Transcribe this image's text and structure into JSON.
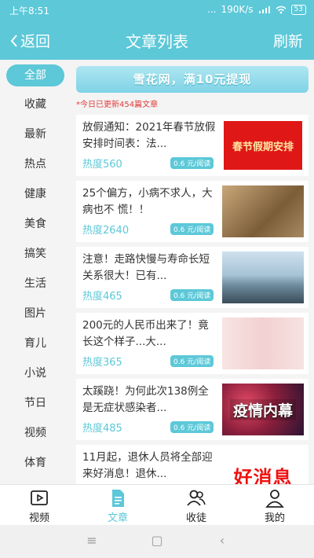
{
  "status_bar": {
    "time": "上午8:51",
    "dots": "...",
    "speed": "190K/s",
    "battery": "53"
  },
  "header": {
    "back_label": "返回",
    "title": "文章列表",
    "refresh_label": "刷新"
  },
  "sidebar": {
    "categories": [
      "全部",
      "收藏",
      "最新",
      "热点",
      "健康",
      "美食",
      "搞笑",
      "生活",
      "图片",
      "育儿",
      "小说",
      "节日",
      "视频",
      "体育"
    ],
    "active_index": 0
  },
  "banner": {
    "text": "雪花网，满10元提现"
  },
  "notice": "*今日已更新454篇文章",
  "articles": [
    {
      "title": "放假通知：2021年春节放假安排时间表：法...",
      "heat": "热度560",
      "price": "0.6 元/阅读",
      "thumb_text": "春节假期安排"
    },
    {
      "title": "25个偏方，小病不求人，大病也不 慌！！",
      "heat": "热度2640",
      "price": "0.6 元/阅读",
      "thumb_text": ""
    },
    {
      "title": "注意！走路快慢与寿命长短关系很大！已有...",
      "heat": "热度465",
      "price": "0.6 元/阅读",
      "thumb_text": ""
    },
    {
      "title": "200元的人民币出来了！竟长这个样子...大...",
      "heat": "热度365",
      "price": "0.6 元/阅读",
      "thumb_text": ""
    },
    {
      "title": "太蹊跷！为何此次138例全是无症状感染者...",
      "heat": "热度485",
      "price": "0.6 元/阅读",
      "thumb_text": "疫情内幕"
    },
    {
      "title": "11月起，退休人员将全部迎来好消息！退休...",
      "heat": "",
      "price": "",
      "thumb_text": "好消息"
    }
  ],
  "tabs": [
    {
      "label": "视频",
      "icon": "video-icon"
    },
    {
      "label": "文章",
      "icon": "document-icon"
    },
    {
      "label": "收徒",
      "icon": "users-icon"
    },
    {
      "label": "我的",
      "icon": "person-icon"
    }
  ],
  "active_tab": 1,
  "colors": {
    "accent": "#5cc8d8",
    "notice_red": "#e23b3b"
  }
}
